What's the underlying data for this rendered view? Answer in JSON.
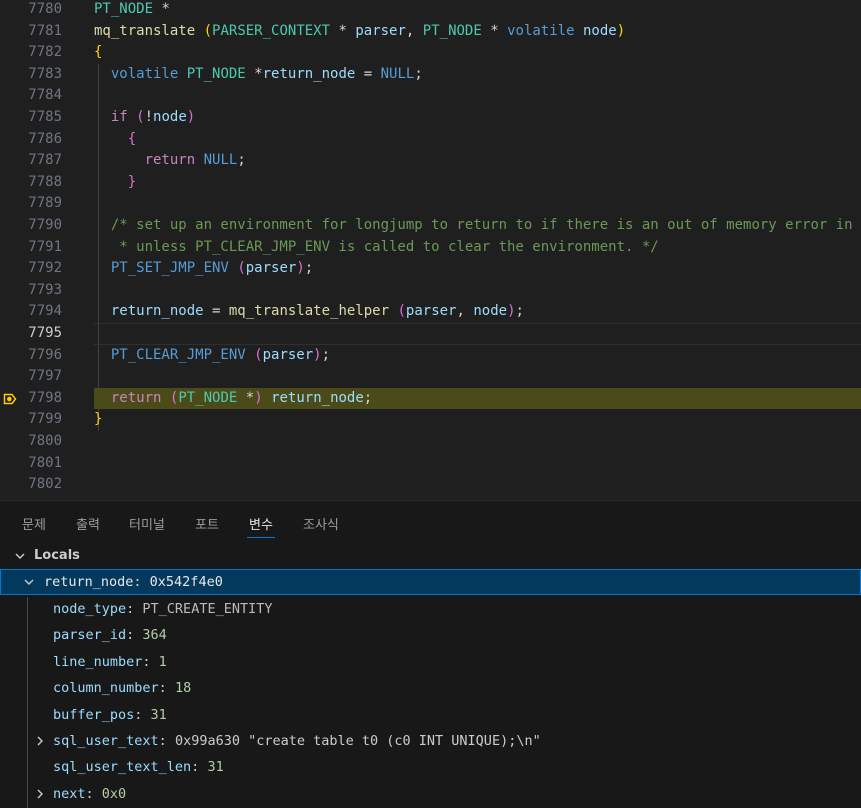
{
  "editor": {
    "lines": [
      {
        "num": "7780",
        "tokens": [
          {
            "t": "PT_NODE",
            "c": "type"
          },
          {
            "t": " *",
            "c": "plain"
          }
        ]
      },
      {
        "num": "7781",
        "tokens": [
          {
            "t": "mq_translate",
            "c": "fn"
          },
          {
            "t": " ",
            "c": "plain"
          },
          {
            "t": "(",
            "c": "p1"
          },
          {
            "t": "PARSER_CONTEXT",
            "c": "type"
          },
          {
            "t": " * ",
            "c": "plain"
          },
          {
            "t": "parser",
            "c": "var"
          },
          {
            "t": ", ",
            "c": "plain"
          },
          {
            "t": "PT_NODE",
            "c": "type"
          },
          {
            "t": " * ",
            "c": "plain"
          },
          {
            "t": "volatile",
            "c": "kw"
          },
          {
            "t": " ",
            "c": "plain"
          },
          {
            "t": "node",
            "c": "var"
          },
          {
            "t": ")",
            "c": "p1"
          }
        ]
      },
      {
        "num": "7782",
        "tokens": [
          {
            "t": "{",
            "c": "p1"
          }
        ]
      },
      {
        "num": "7783",
        "tokens": [
          {
            "t": "  ",
            "c": "plain"
          },
          {
            "t": "volatile",
            "c": "kw"
          },
          {
            "t": " ",
            "c": "plain"
          },
          {
            "t": "PT_NODE",
            "c": "type"
          },
          {
            "t": " *",
            "c": "plain"
          },
          {
            "t": "return_node",
            "c": "var"
          },
          {
            "t": " = ",
            "c": "plain"
          },
          {
            "t": "NULL",
            "c": "macro"
          },
          {
            "t": ";",
            "c": "plain"
          }
        ]
      },
      {
        "num": "7784",
        "tokens": []
      },
      {
        "num": "7785",
        "tokens": [
          {
            "t": "  ",
            "c": "plain"
          },
          {
            "t": "if",
            "c": "ctrl"
          },
          {
            "t": " ",
            "c": "plain"
          },
          {
            "t": "(",
            "c": "p2"
          },
          {
            "t": "!",
            "c": "plain"
          },
          {
            "t": "node",
            "c": "var"
          },
          {
            "t": ")",
            "c": "p2"
          }
        ]
      },
      {
        "num": "7786",
        "tokens": [
          {
            "t": "    ",
            "c": "plain"
          },
          {
            "t": "{",
            "c": "p2"
          }
        ]
      },
      {
        "num": "7787",
        "tokens": [
          {
            "t": "      ",
            "c": "plain"
          },
          {
            "t": "return",
            "c": "ctrl"
          },
          {
            "t": " ",
            "c": "plain"
          },
          {
            "t": "NULL",
            "c": "macro"
          },
          {
            "t": ";",
            "c": "plain"
          }
        ]
      },
      {
        "num": "7788",
        "tokens": [
          {
            "t": "    ",
            "c": "plain"
          },
          {
            "t": "}",
            "c": "p2"
          }
        ]
      },
      {
        "num": "7789",
        "tokens": []
      },
      {
        "num": "7790",
        "tokens": [
          {
            "t": "  ",
            "c": "plain"
          },
          {
            "t": "/* set up an environment for longjump to return to if there is an out of memory error in",
            "c": "com"
          }
        ]
      },
      {
        "num": "7791",
        "tokens": [
          {
            "t": "   * unless PT_CLEAR_JMP_ENV is called to clear the environment. */",
            "c": "com"
          }
        ]
      },
      {
        "num": "7792",
        "tokens": [
          {
            "t": "  ",
            "c": "plain"
          },
          {
            "t": "PT_SET_JMP_ENV",
            "c": "macro"
          },
          {
            "t": " ",
            "c": "plain"
          },
          {
            "t": "(",
            "c": "p2"
          },
          {
            "t": "parser",
            "c": "var"
          },
          {
            "t": ")",
            "c": "p2"
          },
          {
            "t": ";",
            "c": "plain"
          }
        ]
      },
      {
        "num": "7793",
        "tokens": []
      },
      {
        "num": "7794",
        "tokens": [
          {
            "t": "  ",
            "c": "plain"
          },
          {
            "t": "return_node",
            "c": "var"
          },
          {
            "t": " = ",
            "c": "plain"
          },
          {
            "t": "mq_translate_helper",
            "c": "fn"
          },
          {
            "t": " ",
            "c": "plain"
          },
          {
            "t": "(",
            "c": "p2"
          },
          {
            "t": "parser",
            "c": "var"
          },
          {
            "t": ", ",
            "c": "plain"
          },
          {
            "t": "node",
            "c": "var"
          },
          {
            "t": ")",
            "c": "p2"
          },
          {
            "t": ";",
            "c": "plain"
          }
        ]
      },
      {
        "num": "7795",
        "tokens": []
      },
      {
        "num": "7796",
        "tokens": [
          {
            "t": "  ",
            "c": "plain"
          },
          {
            "t": "PT_CLEAR_JMP_ENV",
            "c": "macro"
          },
          {
            "t": " ",
            "c": "plain"
          },
          {
            "t": "(",
            "c": "p2"
          },
          {
            "t": "parser",
            "c": "var"
          },
          {
            "t": ")",
            "c": "p2"
          },
          {
            "t": ";",
            "c": "plain"
          }
        ]
      },
      {
        "num": "7797",
        "tokens": []
      },
      {
        "num": "7798",
        "tokens": [
          {
            "t": "  ",
            "c": "plain"
          },
          {
            "t": "return",
            "c": "ctrl"
          },
          {
            "t": " ",
            "c": "plain"
          },
          {
            "t": "(",
            "c": "p2"
          },
          {
            "t": "PT_NODE",
            "c": "type"
          },
          {
            "t": " *",
            "c": "plain"
          },
          {
            "t": ")",
            "c": "p2"
          },
          {
            "t": " ",
            "c": "plain"
          },
          {
            "t": "return_node",
            "c": "var"
          },
          {
            "t": ";",
            "c": "plain"
          }
        ]
      },
      {
        "num": "7799",
        "tokens": [
          {
            "t": "}",
            "c": "p1"
          }
        ]
      },
      {
        "num": "7800",
        "tokens": []
      },
      {
        "num": "7801",
        "tokens": []
      },
      {
        "num": "7802",
        "tokens": []
      }
    ],
    "cursor_line": "7795",
    "stopped_line": "7798",
    "stop_icon": "debug-stackframe-icon",
    "colors": {
      "background": "#1f1f1f",
      "stop_highlight": "#4b4b1a",
      "stop_marker": "#ffcc00"
    }
  },
  "panel": {
    "tabs": [
      {
        "label": "문제",
        "active": false
      },
      {
        "label": "출력",
        "active": false
      },
      {
        "label": "터미널",
        "active": false
      },
      {
        "label": "포트",
        "active": false
      },
      {
        "label": "변수",
        "active": true
      },
      {
        "label": "조사식",
        "active": false
      }
    ],
    "section_title": "Locals",
    "root": {
      "name": "return_node",
      "value": "0x542f4e0",
      "expanded": true
    },
    "children": [
      {
        "name": "node_type",
        "value": "PT_CREATE_ENTITY",
        "kind": "enum",
        "expandable": false
      },
      {
        "name": "parser_id",
        "value": "364",
        "kind": "num",
        "expandable": false
      },
      {
        "name": "line_number",
        "value": "1",
        "kind": "num",
        "expandable": false
      },
      {
        "name": "column_number",
        "value": "18",
        "kind": "num",
        "expandable": false
      },
      {
        "name": "buffer_pos",
        "value": "31",
        "kind": "num",
        "expandable": false
      },
      {
        "name": "sql_user_text",
        "value": "0x99a630",
        "extra": "\"create table t0 (c0 INT UNIQUE);\\n\"",
        "kind": "ptr",
        "expandable": true
      },
      {
        "name": "sql_user_text_len",
        "value": "31",
        "kind": "num",
        "expandable": false
      },
      {
        "name": "next",
        "value": "0x0",
        "kind": "num",
        "expandable": true
      }
    ]
  }
}
